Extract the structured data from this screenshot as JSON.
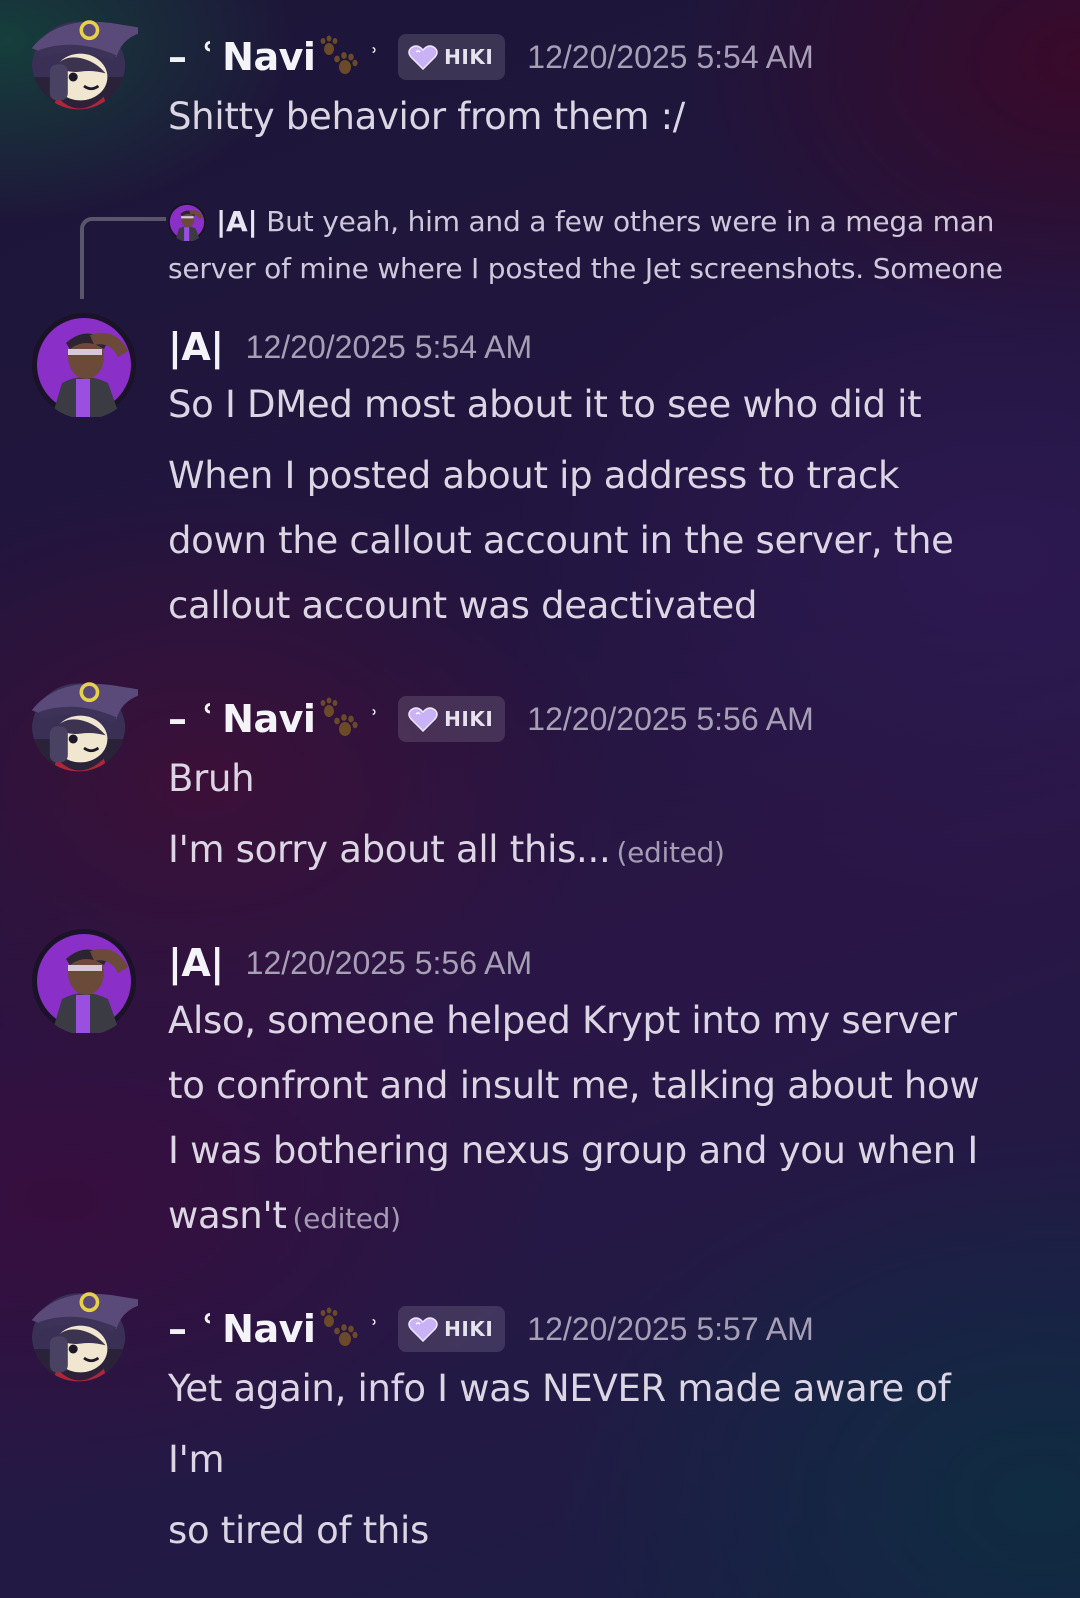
{
  "messages": [
    {
      "author": "Navi",
      "decor_left": "– ʿ",
      "decor_right": "ʾ",
      "tag": "HIKI",
      "timestamp": "12/20/2025 5:54 AM",
      "lines": [
        "Shitty behavior from them :/"
      ]
    },
    {
      "reply": {
        "author": "|A|",
        "text_line1": "But yeah, him and a few others were in a mega man",
        "text_line2": "server of mine where I posted the Jet screenshots. Someone"
      },
      "author": "|A|",
      "timestamp": "12/20/2025 5:54 AM",
      "lines": [
        "So I DMed most about it to see who did it",
        "When I posted about ip address to track",
        "down the callout account in the server, the",
        "callout account was deactivated"
      ]
    },
    {
      "author": "Navi",
      "decor_left": "– ʿ",
      "decor_right": "ʾ",
      "tag": "HIKI",
      "timestamp": "12/20/2025 5:56 AM",
      "lines": [
        "Bruh",
        "I'm sorry about all this..."
      ],
      "edited_label": "(edited)"
    },
    {
      "author": "|A|",
      "timestamp": "12/20/2025 5:56 AM",
      "lines": [
        "Also, someone helped Krypt into my server",
        "to confront and insult me, talking about how",
        "I was bothering nexus group and you when I",
        "wasn't"
      ],
      "edited_label": "(edited)"
    },
    {
      "author": "Navi",
      "decor_left": "– ʿ",
      "decor_right": "ʾ",
      "tag": "HIKI",
      "timestamp": "12/20/2025 5:57 AM",
      "lines": [
        "Yet again, info I was NEVER made aware of",
        "I'm",
        "so tired of this"
      ]
    }
  ],
  "icons": {
    "tag_icon": "heart-shield-icon",
    "paw_icon": "paw-prints-icon",
    "reply_connector": "reply-connector-icon"
  },
  "colors": {
    "tag_heart": "#b89ef0",
    "timestamp": "#a79fb6",
    "text": "#dcd6e4",
    "username": "#f4f4f8"
  }
}
